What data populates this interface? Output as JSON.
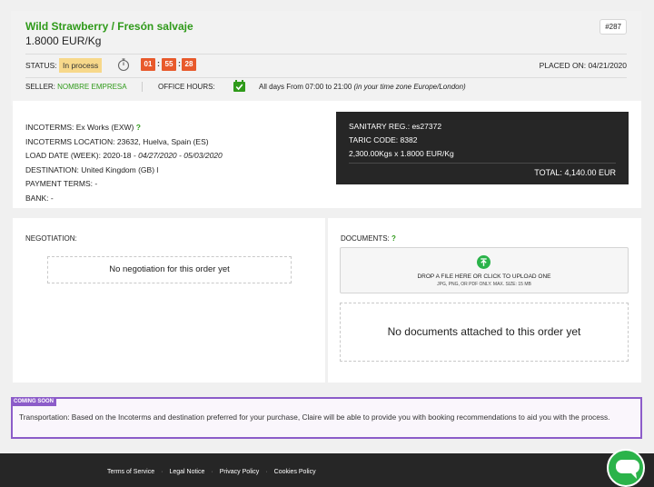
{
  "order": {
    "product": "Wild Strawberry / Fresón salvaje",
    "price": "1.8000 EUR/Kg",
    "id": "#287",
    "status_label": "STATUS:",
    "status_value": "In process",
    "timer": {
      "hours": "01",
      "minutes": "55",
      "seconds": "28"
    },
    "placed_label": "PLACED ON:",
    "placed_date": "04/21/2020",
    "seller_label": "SELLER:",
    "seller_name": "NOMBRE EMPRESA",
    "office_label": "OFFICE HOURS:",
    "office_hours": "All days From 07:00 to 21:00",
    "office_tz": "(in your time zone Europe/London)"
  },
  "details": {
    "incoterms_label": "INCOTERMS:",
    "incoterms_value": "Ex Works (EXW)",
    "help_mark": "?",
    "location_label": "INCOTERMS LOCATION:",
    "location_value": "23632, Huelva, Spain (ES)",
    "load_label": "LOAD DATE (WEEK):",
    "load_week": "2020-18",
    "load_range": "- 04/27/2020 - 05/03/2020",
    "destination_label": "DESTINATION:",
    "destination_value": "United Kingdom (GB) l",
    "payment_label": "PAYMENT TERMS:",
    "payment_value": "-",
    "bank_label": "BANK:",
    "bank_value": "-"
  },
  "summary": {
    "sanitary_label": "SANITARY REG.:",
    "sanitary_value": "es27372",
    "taric_label": "TARIC CODE:",
    "taric_value": "8382",
    "quantity_line": "2,300.00Kgs x 1.8000 EUR/Kg",
    "total_label": "TOTAL:",
    "total_value": "4,140.00 EUR"
  },
  "negotiation": {
    "label": "NEGOTIATION:",
    "empty": "No negotiation for this order yet"
  },
  "documents": {
    "label": "DOCUMENTS:",
    "help_mark": "?",
    "upload_main": "DROP A FILE HERE OR CLICK TO UPLOAD ONE",
    "upload_sub": "JPG, PNG, OR PDF ONLY. MAX. SIZE: 15 MB",
    "empty": "No documents attached to this order yet"
  },
  "coming_soon": {
    "tag": "COMING SOON",
    "text": "Transportation: Based on the Incoterms and destination preferred for your purchase, Claire will be able to provide you with booking recommendations to aid you with the process."
  },
  "footer": {
    "links": [
      "Terms of Service",
      "Legal Notice",
      "Privacy Policy",
      "Cookies Policy"
    ]
  },
  "icons": {
    "timer": "stopwatch-icon",
    "office_hours": "calendar-check-icon",
    "upload": "upload-arrow-icon",
    "chat": "chat-bubble-icon"
  },
  "colors": {
    "brand_green": "#2f9a1a",
    "status_badge": "#f7d88a",
    "timer_orange": "#e85a2c",
    "dark_panel": "#262626",
    "coming_soon_purple": "#8c5cc9",
    "chat_green": "#2bb34a"
  }
}
